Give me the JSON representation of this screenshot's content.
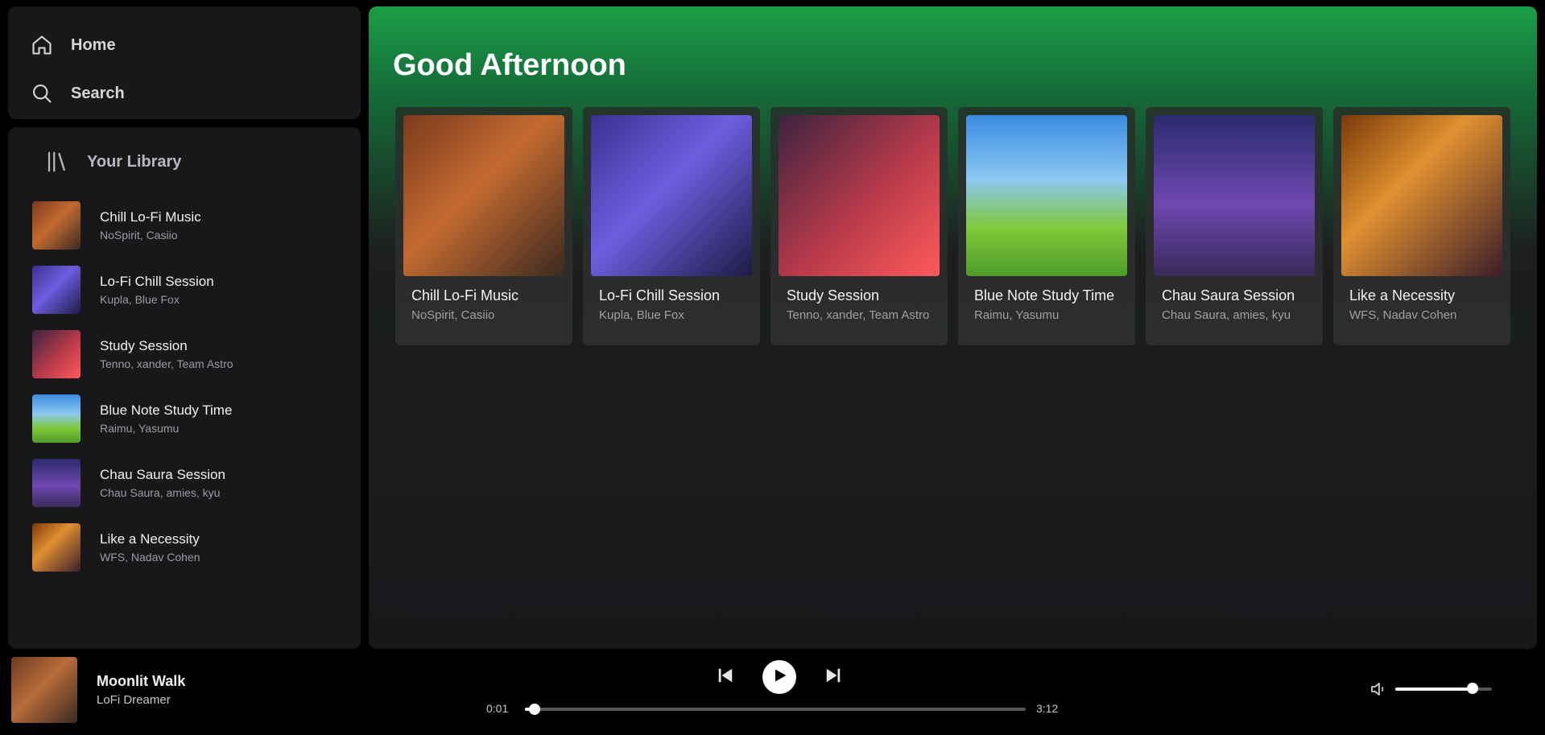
{
  "nav": {
    "home_label": "Home",
    "search_label": "Search",
    "home_icon": "home-icon",
    "search_icon": "search-icon"
  },
  "library": {
    "header": "Your Library",
    "icon": "library-icon",
    "items": [
      {
        "title": "Chill Lo-Fi Music",
        "subtitle": "NoSpirit, Casiio"
      },
      {
        "title": "Lo-Fi Chill Session",
        "subtitle": "Kupla, Blue Fox"
      },
      {
        "title": "Study Session",
        "subtitle": "Tenno, xander, Team Astro"
      },
      {
        "title": "Blue Note Study Time",
        "subtitle": "Raimu, Yasumu"
      },
      {
        "title": "Chau Saura Session",
        "subtitle": "Chau Saura, amies, kyu"
      },
      {
        "title": "Like a Necessity",
        "subtitle": "WFS, Nadav Cohen"
      }
    ]
  },
  "main": {
    "greeting": "Good Afternoon",
    "cards": [
      {
        "title": "Chill Lo-Fi Music",
        "subtitle": "NoSpirit, Casiio"
      },
      {
        "title": "Lo-Fi Chill Session",
        "subtitle": "Kupla, Blue Fox"
      },
      {
        "title": "Study Session",
        "subtitle": "Tenno, xander, Team Astro"
      },
      {
        "title": "Blue Note Study Time",
        "subtitle": "Raimu, Yasumu"
      },
      {
        "title": "Chau Saura Session",
        "subtitle": "Chau Saura, amies, kyu"
      },
      {
        "title": "Like a Necessity",
        "subtitle": "WFS, Nadav Cohen"
      }
    ]
  },
  "player": {
    "track_title": "Moonlit Walk",
    "track_artist": "LoFi Dreamer",
    "current_time": "0:01",
    "total_time": "3:12",
    "progress_fraction": 0.02,
    "volume_fraction": 0.8,
    "controls": [
      "previous-icon",
      "play-icon",
      "next-icon"
    ],
    "volume_icon": "volume-icon"
  },
  "colors": {
    "accent_green": "#1b9e48",
    "panel_bg": "#18181b",
    "app_bg": "#000000"
  }
}
